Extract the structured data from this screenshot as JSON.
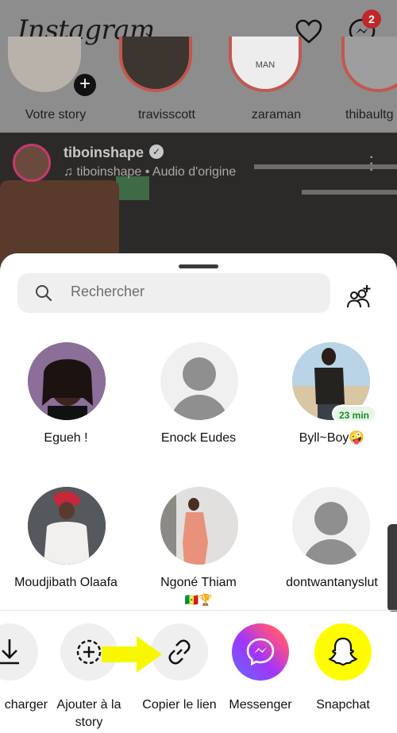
{
  "app": {
    "logo": "Instagram",
    "messages_badge": "2"
  },
  "stories": [
    {
      "label": "Votre story"
    },
    {
      "label": "travisscott"
    },
    {
      "label": "zaraman",
      "ring_text": "MAN"
    },
    {
      "label": "thibaultg"
    }
  ],
  "reel": {
    "username": "tiboinshape",
    "audio": "tiboinshape • Audio d'origine"
  },
  "share_sheet": {
    "search_placeholder": "Rechercher",
    "contacts": [
      {
        "name": "Egueh !"
      },
      {
        "name": "Enock Eudes"
      },
      {
        "name": "Byll~Boy🤪",
        "badge": "23 min"
      },
      {
        "name": "Moudjibath Olaafa"
      },
      {
        "name": "Ngoné Thiam",
        "emoji": "🇸🇳🏆"
      },
      {
        "name": "dontwantanyslut"
      }
    ],
    "actions": [
      {
        "label": "charger"
      },
      {
        "label": "Ajouter à la story"
      },
      {
        "label": "Copier le lien"
      },
      {
        "label": "Messenger"
      },
      {
        "label": "Snapchat"
      }
    ]
  },
  "colors": {
    "messenger_gradient_start": "#a334fa",
    "messenger_gradient_end": "#ff5280",
    "snapchat": "#fffc00",
    "highlight_arrow": "#f7f700",
    "badge_red": "#c0272d"
  }
}
